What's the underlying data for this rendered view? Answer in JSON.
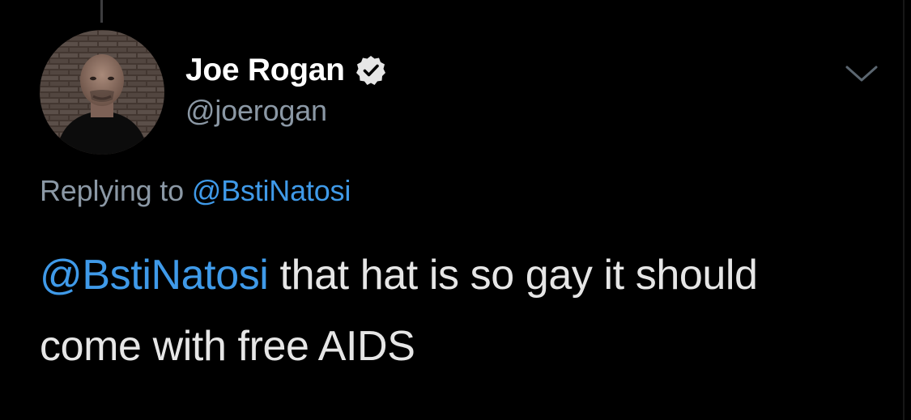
{
  "tweet": {
    "author": {
      "display_name": "Joe Rogan",
      "handle": "@joerogan",
      "verified": true
    },
    "reply_prefix": "Replying to ",
    "reply_to": "@BstiNatosi",
    "body_mention": "@BstiNatosi",
    "body_text": " that hat is so gay it should come with free AIDS",
    "menu_icon": "chevron-down-icon",
    "verified_icon": "verified-badge-icon"
  },
  "colors": {
    "background": "#000000",
    "link": "#3f9ae9",
    "secondary_text": "#8b98a5",
    "primary_text": "#e6e6e6"
  }
}
